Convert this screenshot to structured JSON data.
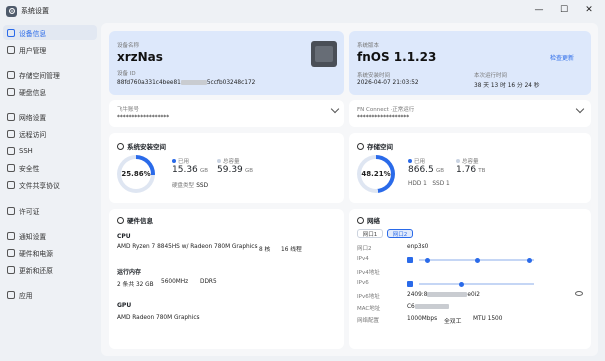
{
  "window": {
    "title": "系统设置",
    "controls": [
      "—",
      "☐",
      "✕"
    ]
  },
  "sidebar": {
    "items": [
      {
        "label": "设备信息",
        "active": true
      },
      {
        "label": "用户管理"
      },
      {
        "label": "存储空间管理"
      },
      {
        "label": "硬盘信息"
      },
      {
        "label": "网络设置"
      },
      {
        "label": "远程访问"
      },
      {
        "label": "SSH"
      },
      {
        "label": "安全性"
      },
      {
        "label": "文件共享协议"
      },
      {
        "label": "许可证"
      },
      {
        "label": "通知设置"
      },
      {
        "label": "硬件和电源"
      },
      {
        "label": "更新和还原"
      },
      {
        "label": "应用"
      }
    ]
  },
  "device": {
    "name_label": "设备名称",
    "name": "xrzNas",
    "id_label": "设备 ID",
    "id_prefix": "88fd760a331c4bee81",
    "id_suffix": "5ccfb03248c172"
  },
  "system": {
    "version_label": "系统版本",
    "version": "fnOS 1.1.23",
    "update_link": "检查更新",
    "install_label": "系统安装时间",
    "install_time": "2026-04-07 21:03:52",
    "uptime_label": "本次运行时间",
    "uptime": "38 天 13 时 16 分 24 秒"
  },
  "feiniu": {
    "label": "飞牛账号",
    "value": "******************"
  },
  "fnconnect": {
    "label": "FN Connect",
    "status": "·正常运行",
    "value": "******************"
  },
  "sys_space": {
    "title": "系统安装空间",
    "percent": "25.86%",
    "percent_value": 25.86,
    "used_label": "已用",
    "used": "15.36",
    "used_unit": "GB",
    "total_label": "总容量",
    "total": "59.39",
    "total_unit": "GB",
    "disk_type_label": "硬盘类型",
    "disk_type": "SSD"
  },
  "storage": {
    "title": "存储空间",
    "percent": "48.21%",
    "percent_value": 48.21,
    "used_label": "已用",
    "used": "866.5",
    "used_unit": "GB",
    "total_label": "总容量",
    "total": "1.76",
    "total_unit": "TB",
    "hdd": "HDD 1",
    "ssd": "SSD 1"
  },
  "hardware": {
    "title": "硬件信息",
    "cpu_label": "CPU",
    "cpu": "AMD Ryzen 7 8845HS w/ Radeon 780M Graphics",
    "cores": "8 核",
    "threads": "16 线程",
    "mem_label": "运行内存",
    "mem_config": "2 条共 32 GB",
    "mem_freq": "5600MHz",
    "mem_type": "DDR5",
    "gpu_label": "GPU",
    "gpu": "AMD Radeon 780M Graphics"
  },
  "network": {
    "title": "网络",
    "tabs": [
      "网口1",
      "网口2"
    ],
    "port_label": "网口2",
    "port_value": "enp3s0",
    "ipv4_label": "IPv4",
    "ipv4_addr_label": "IPv4地址",
    "ipv6_label": "IPv6",
    "ipv6_addr_label": "IPv6地址",
    "ipv6_addr_prefix": "2409:8",
    "ipv6_addr_suffix": "e0i2",
    "mac_label": "MAC地址",
    "mac_prefix": "C6",
    "speed_label": "网络配置",
    "speed": "1000Mbps",
    "duplex": "全双工",
    "mtu": "MTU 1500"
  },
  "colors": {
    "accent": "#2a6ae9",
    "ring_track": "#dfe6f2",
    "blue_card": "#dde8fb"
  }
}
